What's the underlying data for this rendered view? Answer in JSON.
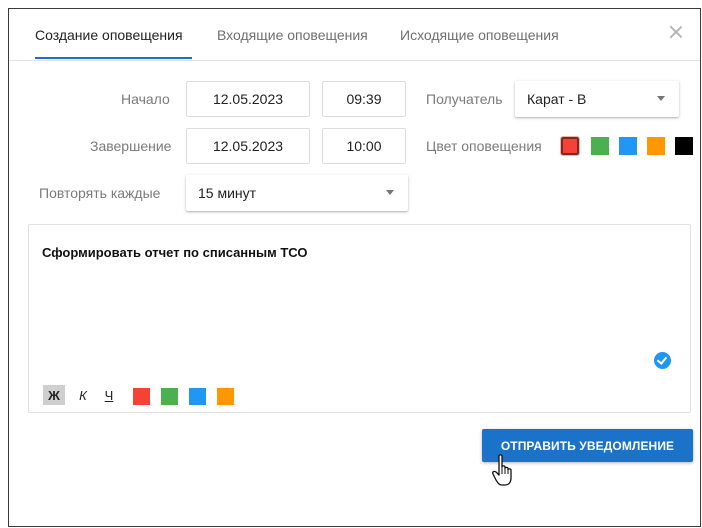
{
  "tabs": {
    "create": "Создание оповещения",
    "incoming": "Входящие оповещения",
    "outgoing": "Исходящие оповещения"
  },
  "form": {
    "start_label": "Начало",
    "start_date": "12.05.2023",
    "start_time": "09:39",
    "end_label": "Завершение",
    "end_date": "12.05.2023",
    "end_time": "10:00",
    "recipient_label": "Получатель",
    "recipient_value": "Карат - В",
    "color_label": "Цвет оповещения",
    "repeat_label": "Повторять каждые",
    "repeat_value": "15 минут"
  },
  "colors": {
    "red": "#f44336",
    "green": "#4caf50",
    "blue": "#2196f3",
    "orange": "#ff9800",
    "black": "#000000",
    "selected": "red"
  },
  "editor": {
    "text": "Сформировать отчет по списанным ТСО",
    "bold_label": "Ж",
    "italic_label": "К",
    "underline_label": "Ч"
  },
  "actions": {
    "send_label": "ОТПРАВИТЬ УВЕДОМЛЕНИЕ"
  }
}
